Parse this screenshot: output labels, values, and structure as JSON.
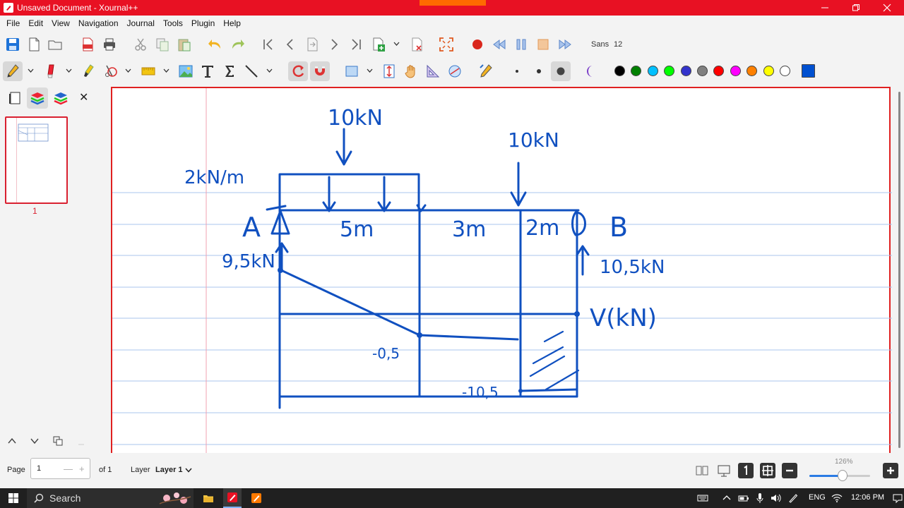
{
  "window": {
    "title": "Unsaved Document - Xournal++"
  },
  "menu": [
    "File",
    "Edit",
    "View",
    "Navigation",
    "Journal",
    "Tools",
    "Plugin",
    "Help"
  ],
  "toolbar": {
    "font_name": "Sans",
    "font_size": "12"
  },
  "colors": {
    "palette": [
      "#000000",
      "#008000",
      "#00c0ff",
      "#00ff00",
      "#3333cc",
      "#808080",
      "#ff0000",
      "#ff00ff",
      "#ff8000",
      "#ffff00",
      "#ffffff",
      "#0050d0"
    ],
    "ink": "#1050c0",
    "title_bar": "#e81123"
  },
  "sidebar": {
    "page_number": "1"
  },
  "statusbar": {
    "page_label": "Page",
    "page_value": "1",
    "of_label": "of 1",
    "layer_label": "Layer",
    "layer_value": "Layer 1",
    "zoom": "126%",
    "zoom_slider_fraction": 0.55
  },
  "drawing": {
    "load1": "10kN",
    "load2": "10kN",
    "distributed_load": "2kN/m",
    "support_a": "A",
    "support_b": "B",
    "reaction_a": "9,5kN",
    "reaction_b": "10,5kN",
    "span1": "5m",
    "span2": "3m",
    "span3": "2m",
    "shear_label": "V(kN)",
    "value1": "-0,5",
    "value2": "-10,5"
  },
  "taskbar": {
    "search_placeholder": "Search",
    "language": "ENG",
    "time": "12:06 PM"
  }
}
